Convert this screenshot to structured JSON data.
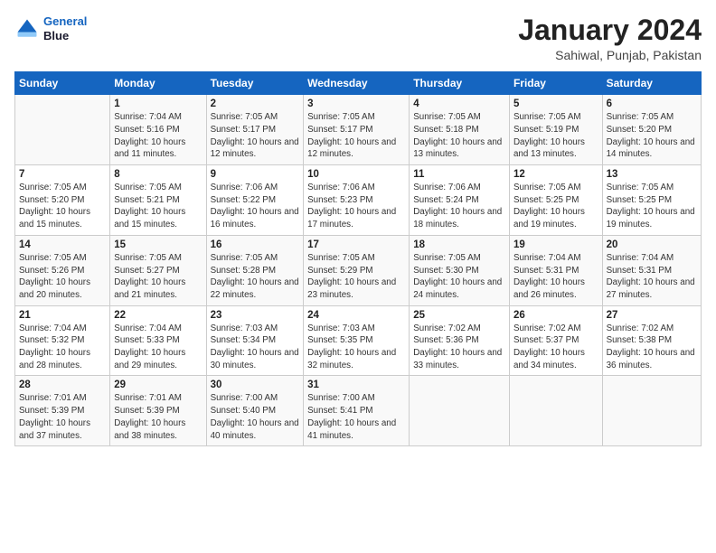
{
  "header": {
    "logo_line1": "General",
    "logo_line2": "Blue",
    "title": "January 2024",
    "subtitle": "Sahiwal, Punjab, Pakistan"
  },
  "calendar": {
    "days": [
      "Sunday",
      "Monday",
      "Tuesday",
      "Wednesday",
      "Thursday",
      "Friday",
      "Saturday"
    ],
    "weeks": [
      [
        {
          "date": "",
          "sunrise": "",
          "sunset": "",
          "daylight": ""
        },
        {
          "date": "1",
          "sunrise": "Sunrise: 7:04 AM",
          "sunset": "Sunset: 5:16 PM",
          "daylight": "Daylight: 10 hours and 11 minutes."
        },
        {
          "date": "2",
          "sunrise": "Sunrise: 7:05 AM",
          "sunset": "Sunset: 5:17 PM",
          "daylight": "Daylight: 10 hours and 12 minutes."
        },
        {
          "date": "3",
          "sunrise": "Sunrise: 7:05 AM",
          "sunset": "Sunset: 5:17 PM",
          "daylight": "Daylight: 10 hours and 12 minutes."
        },
        {
          "date": "4",
          "sunrise": "Sunrise: 7:05 AM",
          "sunset": "Sunset: 5:18 PM",
          "daylight": "Daylight: 10 hours and 13 minutes."
        },
        {
          "date": "5",
          "sunrise": "Sunrise: 7:05 AM",
          "sunset": "Sunset: 5:19 PM",
          "daylight": "Daylight: 10 hours and 13 minutes."
        },
        {
          "date": "6",
          "sunrise": "Sunrise: 7:05 AM",
          "sunset": "Sunset: 5:20 PM",
          "daylight": "Daylight: 10 hours and 14 minutes."
        }
      ],
      [
        {
          "date": "7",
          "sunrise": "Sunrise: 7:05 AM",
          "sunset": "Sunset: 5:20 PM",
          "daylight": "Daylight: 10 hours and 15 minutes."
        },
        {
          "date": "8",
          "sunrise": "Sunrise: 7:05 AM",
          "sunset": "Sunset: 5:21 PM",
          "daylight": "Daylight: 10 hours and 15 minutes."
        },
        {
          "date": "9",
          "sunrise": "Sunrise: 7:06 AM",
          "sunset": "Sunset: 5:22 PM",
          "daylight": "Daylight: 10 hours and 16 minutes."
        },
        {
          "date": "10",
          "sunrise": "Sunrise: 7:06 AM",
          "sunset": "Sunset: 5:23 PM",
          "daylight": "Daylight: 10 hours and 17 minutes."
        },
        {
          "date": "11",
          "sunrise": "Sunrise: 7:06 AM",
          "sunset": "Sunset: 5:24 PM",
          "daylight": "Daylight: 10 hours and 18 minutes."
        },
        {
          "date": "12",
          "sunrise": "Sunrise: 7:05 AM",
          "sunset": "Sunset: 5:25 PM",
          "daylight": "Daylight: 10 hours and 19 minutes."
        },
        {
          "date": "13",
          "sunrise": "Sunrise: 7:05 AM",
          "sunset": "Sunset: 5:25 PM",
          "daylight": "Daylight: 10 hours and 19 minutes."
        }
      ],
      [
        {
          "date": "14",
          "sunrise": "Sunrise: 7:05 AM",
          "sunset": "Sunset: 5:26 PM",
          "daylight": "Daylight: 10 hours and 20 minutes."
        },
        {
          "date": "15",
          "sunrise": "Sunrise: 7:05 AM",
          "sunset": "Sunset: 5:27 PM",
          "daylight": "Daylight: 10 hours and 21 minutes."
        },
        {
          "date": "16",
          "sunrise": "Sunrise: 7:05 AM",
          "sunset": "Sunset: 5:28 PM",
          "daylight": "Daylight: 10 hours and 22 minutes."
        },
        {
          "date": "17",
          "sunrise": "Sunrise: 7:05 AM",
          "sunset": "Sunset: 5:29 PM",
          "daylight": "Daylight: 10 hours and 23 minutes."
        },
        {
          "date": "18",
          "sunrise": "Sunrise: 7:05 AM",
          "sunset": "Sunset: 5:30 PM",
          "daylight": "Daylight: 10 hours and 24 minutes."
        },
        {
          "date": "19",
          "sunrise": "Sunrise: 7:04 AM",
          "sunset": "Sunset: 5:31 PM",
          "daylight": "Daylight: 10 hours and 26 minutes."
        },
        {
          "date": "20",
          "sunrise": "Sunrise: 7:04 AM",
          "sunset": "Sunset: 5:31 PM",
          "daylight": "Daylight: 10 hours and 27 minutes."
        }
      ],
      [
        {
          "date": "21",
          "sunrise": "Sunrise: 7:04 AM",
          "sunset": "Sunset: 5:32 PM",
          "daylight": "Daylight: 10 hours and 28 minutes."
        },
        {
          "date": "22",
          "sunrise": "Sunrise: 7:04 AM",
          "sunset": "Sunset: 5:33 PM",
          "daylight": "Daylight: 10 hours and 29 minutes."
        },
        {
          "date": "23",
          "sunrise": "Sunrise: 7:03 AM",
          "sunset": "Sunset: 5:34 PM",
          "daylight": "Daylight: 10 hours and 30 minutes."
        },
        {
          "date": "24",
          "sunrise": "Sunrise: 7:03 AM",
          "sunset": "Sunset: 5:35 PM",
          "daylight": "Daylight: 10 hours and 32 minutes."
        },
        {
          "date": "25",
          "sunrise": "Sunrise: 7:02 AM",
          "sunset": "Sunset: 5:36 PM",
          "daylight": "Daylight: 10 hours and 33 minutes."
        },
        {
          "date": "26",
          "sunrise": "Sunrise: 7:02 AM",
          "sunset": "Sunset: 5:37 PM",
          "daylight": "Daylight: 10 hours and 34 minutes."
        },
        {
          "date": "27",
          "sunrise": "Sunrise: 7:02 AM",
          "sunset": "Sunset: 5:38 PM",
          "daylight": "Daylight: 10 hours and 36 minutes."
        }
      ],
      [
        {
          "date": "28",
          "sunrise": "Sunrise: 7:01 AM",
          "sunset": "Sunset: 5:39 PM",
          "daylight": "Daylight: 10 hours and 37 minutes."
        },
        {
          "date": "29",
          "sunrise": "Sunrise: 7:01 AM",
          "sunset": "Sunset: 5:39 PM",
          "daylight": "Daylight: 10 hours and 38 minutes."
        },
        {
          "date": "30",
          "sunrise": "Sunrise: 7:00 AM",
          "sunset": "Sunset: 5:40 PM",
          "daylight": "Daylight: 10 hours and 40 minutes."
        },
        {
          "date": "31",
          "sunrise": "Sunrise: 7:00 AM",
          "sunset": "Sunset: 5:41 PM",
          "daylight": "Daylight: 10 hours and 41 minutes."
        },
        {
          "date": "",
          "sunrise": "",
          "sunset": "",
          "daylight": ""
        },
        {
          "date": "",
          "sunrise": "",
          "sunset": "",
          "daylight": ""
        },
        {
          "date": "",
          "sunrise": "",
          "sunset": "",
          "daylight": ""
        }
      ]
    ]
  }
}
